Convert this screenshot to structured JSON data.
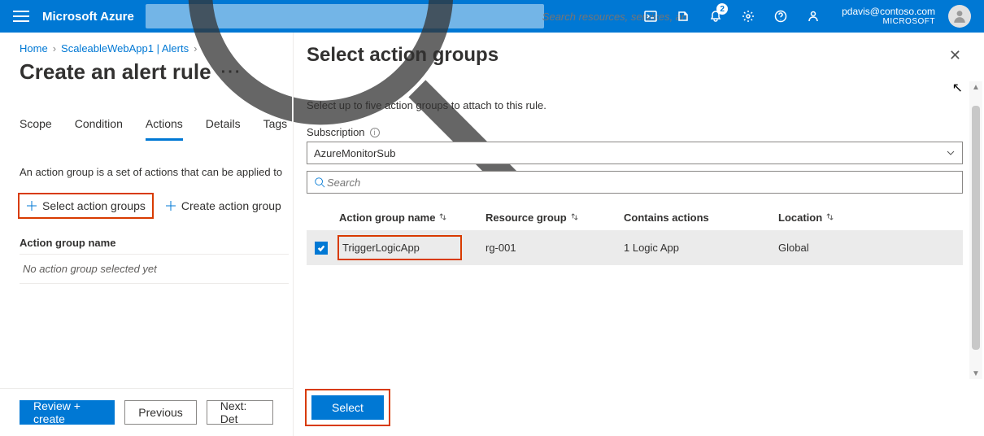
{
  "header": {
    "brand": "Microsoft Azure",
    "search_placeholder": "Search resources, services, and docs (G+/)",
    "notification_count": "2",
    "user_email": "pdavis@contoso.com",
    "tenant": "MICROSOFT"
  },
  "breadcrumb": [
    "Home",
    "ScaleableWebApp1 | Alerts"
  ],
  "page_title": "Create an alert rule",
  "tabs": [
    "Scope",
    "Condition",
    "Actions",
    "Details",
    "Tags"
  ],
  "active_tab_index": 2,
  "left": {
    "description": "An action group is a set of actions that can be applied to",
    "select_btn": "Select action groups",
    "create_btn": "Create action group",
    "mini_header": "Action group name",
    "mini_empty": "No action group selected yet"
  },
  "bottom_buttons": {
    "review": "Review + create",
    "previous": "Previous",
    "next": "Next: Det"
  },
  "panel": {
    "title": "Select action groups",
    "subtitle": "Select up to five action groups to attach to this rule.",
    "sub_label": "Subscription",
    "sub_value": "AzureMonitorSub",
    "search_placeholder": "Search",
    "columns": [
      "Action group name",
      "Resource group",
      "Contains actions",
      "Location"
    ],
    "rows": [
      {
        "name": "TriggerLogicApp",
        "rg": "rg-001",
        "actions": "1 Logic App",
        "location": "Global",
        "checked": true
      }
    ],
    "select_btn": "Select"
  }
}
